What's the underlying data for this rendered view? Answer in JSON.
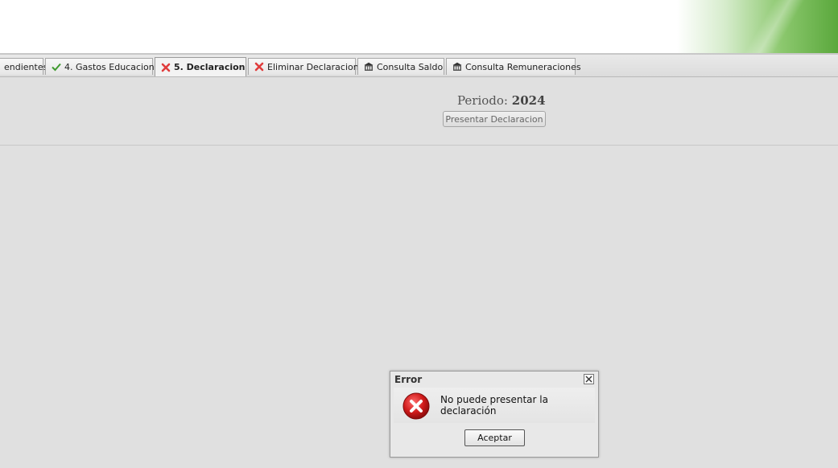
{
  "tabs": [
    {
      "label": "endientes",
      "icon": "none",
      "active": false
    },
    {
      "label": "4. Gastos Educacion",
      "icon": "check-icon",
      "active": false
    },
    {
      "label": "5. Declaracion",
      "icon": "x-icon",
      "active": true
    },
    {
      "label": "Eliminar Declaracion",
      "icon": "x-icon",
      "active": false
    },
    {
      "label": "Consulta Saldo",
      "icon": "building-icon",
      "active": false
    },
    {
      "label": "Consulta Remuneraciones",
      "icon": "building-icon",
      "active": false
    }
  ],
  "main": {
    "periodo_label": "Periodo:",
    "periodo_value": "2024",
    "present_button": "Presentar Declaracion"
  },
  "dialog": {
    "title": "Error",
    "message": "No puede presentar la declaración",
    "ok_button": "Aceptar",
    "icon": "error-icon"
  },
  "colors": {
    "check": "#3e9a2e",
    "x_mark": "#e03c3c",
    "error_red": "#c8102e",
    "brand_green": "#5aa83c"
  }
}
